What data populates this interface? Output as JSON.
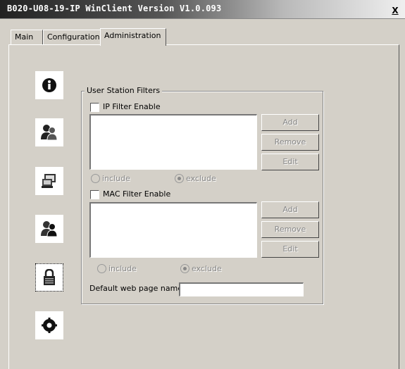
{
  "window": {
    "title": "B020-U08-19-IP WinClient Version V1.0.093",
    "close_label": "X"
  },
  "tabs": [
    {
      "label": "Main",
      "active": false
    },
    {
      "label": "Configuration",
      "active": false
    },
    {
      "label": "Administration",
      "active": true
    }
  ],
  "sidebar": {
    "icons": [
      {
        "name": "info-icon"
      },
      {
        "name": "users-icon"
      },
      {
        "name": "computer-icon"
      },
      {
        "name": "user-admin-icon"
      },
      {
        "name": "lock-icon",
        "selected": true
      },
      {
        "name": "gear-icon"
      }
    ]
  },
  "filters": {
    "group_label": "User Station Filters",
    "ip": {
      "enable_label": "IP Filter Enable",
      "checked": false,
      "buttons": {
        "add": "Add",
        "remove": "Remove",
        "edit": "Edit"
      },
      "include_label": "include",
      "exclude_label": "exclude",
      "selected_mode": "exclude"
    },
    "mac": {
      "enable_label": "MAC Filter Enable",
      "checked": false,
      "buttons": {
        "add": "Add",
        "remove": "Remove",
        "edit": "Edit"
      },
      "include_label": "include",
      "exclude_label": "exclude",
      "selected_mode": "exclude"
    },
    "default_page": {
      "label": "Default web page name",
      "value": ""
    }
  }
}
